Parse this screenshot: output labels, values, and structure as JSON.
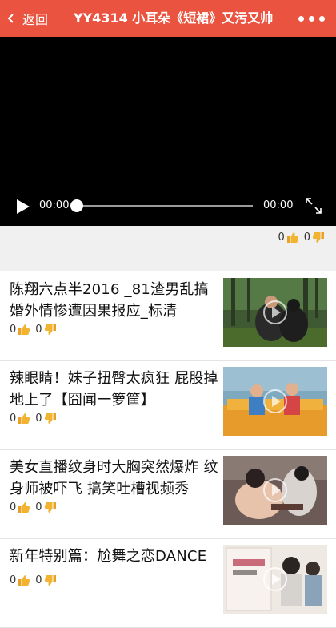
{
  "topbar": {
    "back_label": "返回",
    "title": "YY4314 小耳朵《短裙》又污又帅",
    "accent": "#e9533f"
  },
  "player": {
    "current_time": "00:00",
    "duration": "00:00",
    "progress": 0
  },
  "video_reactions": {
    "likes": "0",
    "dislikes": "0"
  },
  "related": [
    {
      "title": "陈翔六点半2016 _81渣男乱搞婚外情惨遭因果报应_标清",
      "likes": "0",
      "dislikes": "0",
      "thumb": "forest-couple"
    },
    {
      "title": "辣眼睛！妹子扭臀太疯狂 屁股掉地上了【囧闻一箩筐】",
      "likes": "0",
      "dislikes": "0",
      "thumb": "couch-dance"
    },
    {
      "title": "美女直播纹身时大胸突然爆炸 纹身师被吓飞 搞笑吐槽视频秀",
      "likes": "0",
      "dislikes": "0",
      "thumb": "tattoo-livestream"
    },
    {
      "title": "新年特别篇：尬舞之恋DANCE",
      "likes": "0",
      "dislikes": "0",
      "thumb": "dance-poster"
    }
  ]
}
